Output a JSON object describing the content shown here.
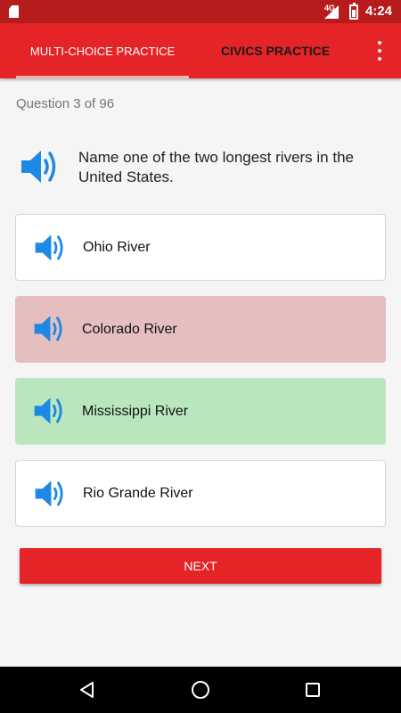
{
  "status_bar": {
    "time": "4:24",
    "network": "4G"
  },
  "tabs": [
    {
      "label": "MULTI-CHOICE PRACTICE",
      "active": true
    },
    {
      "label": "CIVICS PRACTICE",
      "active": false
    }
  ],
  "progress": "Question 3 of 96",
  "question": "Name one of the two longest rivers in the United States.",
  "answers": [
    {
      "label": "Ohio River",
      "state": "neutral"
    },
    {
      "label": "Colorado River",
      "state": "incorrect"
    },
    {
      "label": "Mississippi River",
      "state": "correct"
    },
    {
      "label": "Rio Grande River",
      "state": "neutral"
    }
  ],
  "next_label": "NEXT",
  "colors": {
    "primary": "#e52427",
    "status_bar": "#b71c1c",
    "speaker_blue": "#1e88e5",
    "incorrect_bg": "#e5bfbf",
    "correct_bg": "#b9e6bd"
  }
}
